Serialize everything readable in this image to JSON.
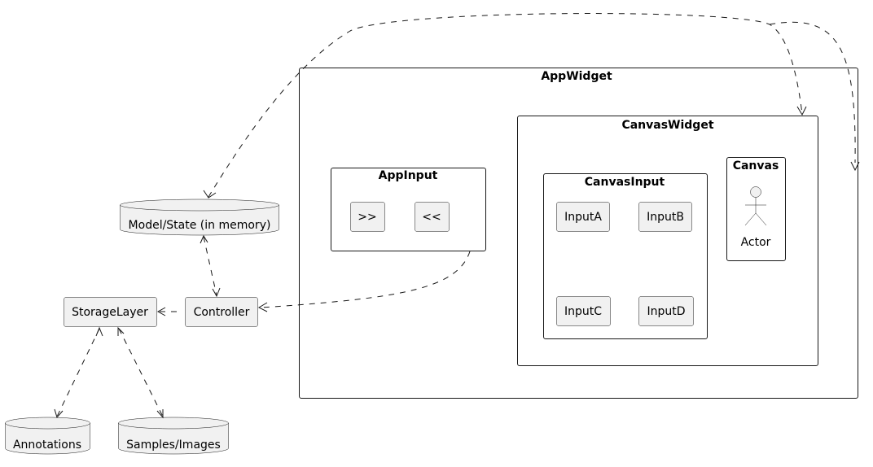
{
  "diagram": {
    "packages": {
      "app_widget": "AppWidget",
      "canvas_widget": "CanvasWidget",
      "canvas": "Canvas",
      "canvas_input": "CanvasInput",
      "app_input": "AppInput"
    },
    "nodes": {
      "actor": "Actor",
      "input_a": "InputA",
      "input_b": "InputB",
      "input_c": "InputC",
      "input_d": "InputD",
      "forward": ">>",
      "back": "<<",
      "model_state": "Model/State (in memory)",
      "controller": "Controller",
      "storage_layer": "StorageLayer",
      "annotations": "Annotations",
      "samples_images": "Samples/Images"
    },
    "colors": {
      "node_fill": "#f1f1f1",
      "line": "#181818"
    }
  }
}
